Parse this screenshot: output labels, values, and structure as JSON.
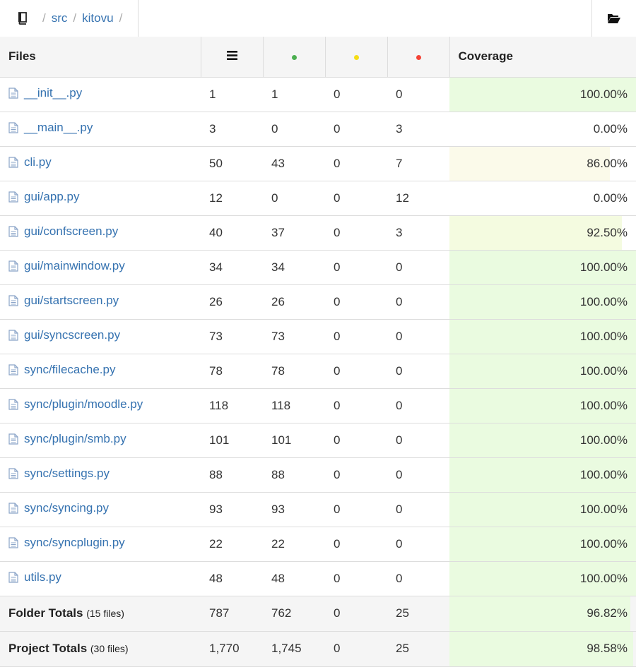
{
  "breadcrumb": {
    "items": [
      "src",
      "kitovu"
    ],
    "separator": "/",
    "book_icon": "book-icon",
    "folder_icon": "folder-open-icon"
  },
  "table": {
    "headers": {
      "files": "Files",
      "coverage": "Coverage",
      "lines_icon": "lines-icon",
      "covered_icon": "green-dot",
      "partial_icon": "yellow-dot",
      "missed_icon": "red-dot"
    },
    "colors": {
      "covered": "#4caf50",
      "partial": "#f5dd16",
      "missed": "#f44336",
      "good": "#eafbe0",
      "ok": "#f4fbe0",
      "warn": "#fbfaea"
    },
    "rows": [
      {
        "file": "__init__.py",
        "total": "1",
        "covered": "1",
        "partial": "0",
        "missed": "0",
        "coverage": "100.00%",
        "pct": 100
      },
      {
        "file": "__main__.py",
        "total": "3",
        "covered": "0",
        "partial": "0",
        "missed": "3",
        "coverage": "0.00%",
        "pct": 0
      },
      {
        "file": "cli.py",
        "total": "50",
        "covered": "43",
        "partial": "0",
        "missed": "7",
        "coverage": "86.00%",
        "pct": 86
      },
      {
        "file": "gui/app.py",
        "total": "12",
        "covered": "0",
        "partial": "0",
        "missed": "12",
        "coverage": "0.00%",
        "pct": 0
      },
      {
        "file": "gui/confscreen.py",
        "total": "40",
        "covered": "37",
        "partial": "0",
        "missed": "3",
        "coverage": "92.50%",
        "pct": 92.5
      },
      {
        "file": "gui/mainwindow.py",
        "total": "34",
        "covered": "34",
        "partial": "0",
        "missed": "0",
        "coverage": "100.00%",
        "pct": 100
      },
      {
        "file": "gui/startscreen.py",
        "total": "26",
        "covered": "26",
        "partial": "0",
        "missed": "0",
        "coverage": "100.00%",
        "pct": 100
      },
      {
        "file": "gui/syncscreen.py",
        "total": "73",
        "covered": "73",
        "partial": "0",
        "missed": "0",
        "coverage": "100.00%",
        "pct": 100
      },
      {
        "file": "sync/filecache.py",
        "total": "78",
        "covered": "78",
        "partial": "0",
        "missed": "0",
        "coverage": "100.00%",
        "pct": 100
      },
      {
        "file": "sync/plugin/moodle.py",
        "total": "118",
        "covered": "118",
        "partial": "0",
        "missed": "0",
        "coverage": "100.00%",
        "pct": 100
      },
      {
        "file": "sync/plugin/smb.py",
        "total": "101",
        "covered": "101",
        "partial": "0",
        "missed": "0",
        "coverage": "100.00%",
        "pct": 100
      },
      {
        "file": "sync/settings.py",
        "total": "88",
        "covered": "88",
        "partial": "0",
        "missed": "0",
        "coverage": "100.00%",
        "pct": 100
      },
      {
        "file": "sync/syncing.py",
        "total": "93",
        "covered": "93",
        "partial": "0",
        "missed": "0",
        "coverage": "100.00%",
        "pct": 100
      },
      {
        "file": "sync/syncplugin.py",
        "total": "22",
        "covered": "22",
        "partial": "0",
        "missed": "0",
        "coverage": "100.00%",
        "pct": 100
      },
      {
        "file": "utils.py",
        "total": "48",
        "covered": "48",
        "partial": "0",
        "missed": "0",
        "coverage": "100.00%",
        "pct": 100
      }
    ],
    "folder_totals": {
      "label": "Folder Totals",
      "files": "(15 files)",
      "total": "787",
      "covered": "762",
      "partial": "0",
      "missed": "25",
      "coverage": "96.82%",
      "pct": 96.82
    },
    "project_totals": {
      "label": "Project Totals",
      "files": "(30 files)",
      "total": "1,770",
      "covered": "1,745",
      "partial": "0",
      "missed": "25",
      "coverage": "98.58%",
      "pct": 98.58
    }
  }
}
